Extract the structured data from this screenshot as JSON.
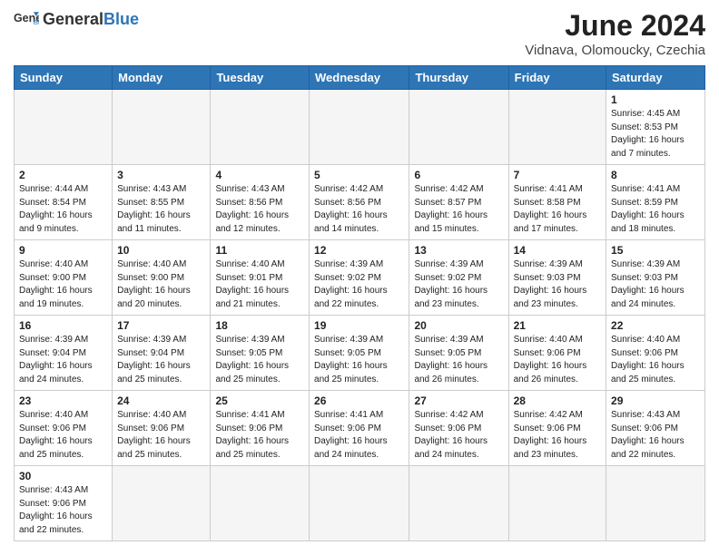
{
  "header": {
    "logo_general": "General",
    "logo_blue": "Blue",
    "title": "June 2024",
    "subtitle": "Vidnava, Olomoucky, Czechia"
  },
  "weekdays": [
    "Sunday",
    "Monday",
    "Tuesday",
    "Wednesday",
    "Thursday",
    "Friday",
    "Saturday"
  ],
  "weeks": [
    [
      {
        "day": "",
        "info": ""
      },
      {
        "day": "",
        "info": ""
      },
      {
        "day": "",
        "info": ""
      },
      {
        "day": "",
        "info": ""
      },
      {
        "day": "",
        "info": ""
      },
      {
        "day": "",
        "info": ""
      },
      {
        "day": "1",
        "info": "Sunrise: 4:45 AM\nSunset: 8:53 PM\nDaylight: 16 hours\nand 7 minutes."
      }
    ],
    [
      {
        "day": "2",
        "info": "Sunrise: 4:44 AM\nSunset: 8:54 PM\nDaylight: 16 hours\nand 9 minutes."
      },
      {
        "day": "3",
        "info": "Sunrise: 4:43 AM\nSunset: 8:55 PM\nDaylight: 16 hours\nand 11 minutes."
      },
      {
        "day": "4",
        "info": "Sunrise: 4:43 AM\nSunset: 8:56 PM\nDaylight: 16 hours\nand 12 minutes."
      },
      {
        "day": "5",
        "info": "Sunrise: 4:42 AM\nSunset: 8:56 PM\nDaylight: 16 hours\nand 14 minutes."
      },
      {
        "day": "6",
        "info": "Sunrise: 4:42 AM\nSunset: 8:57 PM\nDaylight: 16 hours\nand 15 minutes."
      },
      {
        "day": "7",
        "info": "Sunrise: 4:41 AM\nSunset: 8:58 PM\nDaylight: 16 hours\nand 17 minutes."
      },
      {
        "day": "8",
        "info": "Sunrise: 4:41 AM\nSunset: 8:59 PM\nDaylight: 16 hours\nand 18 minutes."
      }
    ],
    [
      {
        "day": "9",
        "info": "Sunrise: 4:40 AM\nSunset: 9:00 PM\nDaylight: 16 hours\nand 19 minutes."
      },
      {
        "day": "10",
        "info": "Sunrise: 4:40 AM\nSunset: 9:00 PM\nDaylight: 16 hours\nand 20 minutes."
      },
      {
        "day": "11",
        "info": "Sunrise: 4:40 AM\nSunset: 9:01 PM\nDaylight: 16 hours\nand 21 minutes."
      },
      {
        "day": "12",
        "info": "Sunrise: 4:39 AM\nSunset: 9:02 PM\nDaylight: 16 hours\nand 22 minutes."
      },
      {
        "day": "13",
        "info": "Sunrise: 4:39 AM\nSunset: 9:02 PM\nDaylight: 16 hours\nand 23 minutes."
      },
      {
        "day": "14",
        "info": "Sunrise: 4:39 AM\nSunset: 9:03 PM\nDaylight: 16 hours\nand 23 minutes."
      },
      {
        "day": "15",
        "info": "Sunrise: 4:39 AM\nSunset: 9:03 PM\nDaylight: 16 hours\nand 24 minutes."
      }
    ],
    [
      {
        "day": "16",
        "info": "Sunrise: 4:39 AM\nSunset: 9:04 PM\nDaylight: 16 hours\nand 24 minutes."
      },
      {
        "day": "17",
        "info": "Sunrise: 4:39 AM\nSunset: 9:04 PM\nDaylight: 16 hours\nand 25 minutes."
      },
      {
        "day": "18",
        "info": "Sunrise: 4:39 AM\nSunset: 9:05 PM\nDaylight: 16 hours\nand 25 minutes."
      },
      {
        "day": "19",
        "info": "Sunrise: 4:39 AM\nSunset: 9:05 PM\nDaylight: 16 hours\nand 25 minutes."
      },
      {
        "day": "20",
        "info": "Sunrise: 4:39 AM\nSunset: 9:05 PM\nDaylight: 16 hours\nand 26 minutes."
      },
      {
        "day": "21",
        "info": "Sunrise: 4:40 AM\nSunset: 9:06 PM\nDaylight: 16 hours\nand 26 minutes."
      },
      {
        "day": "22",
        "info": "Sunrise: 4:40 AM\nSunset: 9:06 PM\nDaylight: 16 hours\nand 25 minutes."
      }
    ],
    [
      {
        "day": "23",
        "info": "Sunrise: 4:40 AM\nSunset: 9:06 PM\nDaylight: 16 hours\nand 25 minutes."
      },
      {
        "day": "24",
        "info": "Sunrise: 4:40 AM\nSunset: 9:06 PM\nDaylight: 16 hours\nand 25 minutes."
      },
      {
        "day": "25",
        "info": "Sunrise: 4:41 AM\nSunset: 9:06 PM\nDaylight: 16 hours\nand 25 minutes."
      },
      {
        "day": "26",
        "info": "Sunrise: 4:41 AM\nSunset: 9:06 PM\nDaylight: 16 hours\nand 24 minutes."
      },
      {
        "day": "27",
        "info": "Sunrise: 4:42 AM\nSunset: 9:06 PM\nDaylight: 16 hours\nand 24 minutes."
      },
      {
        "day": "28",
        "info": "Sunrise: 4:42 AM\nSunset: 9:06 PM\nDaylight: 16 hours\nand 23 minutes."
      },
      {
        "day": "29",
        "info": "Sunrise: 4:43 AM\nSunset: 9:06 PM\nDaylight: 16 hours\nand 22 minutes."
      }
    ],
    [
      {
        "day": "30",
        "info": "Sunrise: 4:43 AM\nSunset: 9:06 PM\nDaylight: 16 hours\nand 22 minutes."
      },
      {
        "day": "",
        "info": ""
      },
      {
        "day": "",
        "info": ""
      },
      {
        "day": "",
        "info": ""
      },
      {
        "day": "",
        "info": ""
      },
      {
        "day": "",
        "info": ""
      },
      {
        "day": "",
        "info": ""
      }
    ]
  ]
}
